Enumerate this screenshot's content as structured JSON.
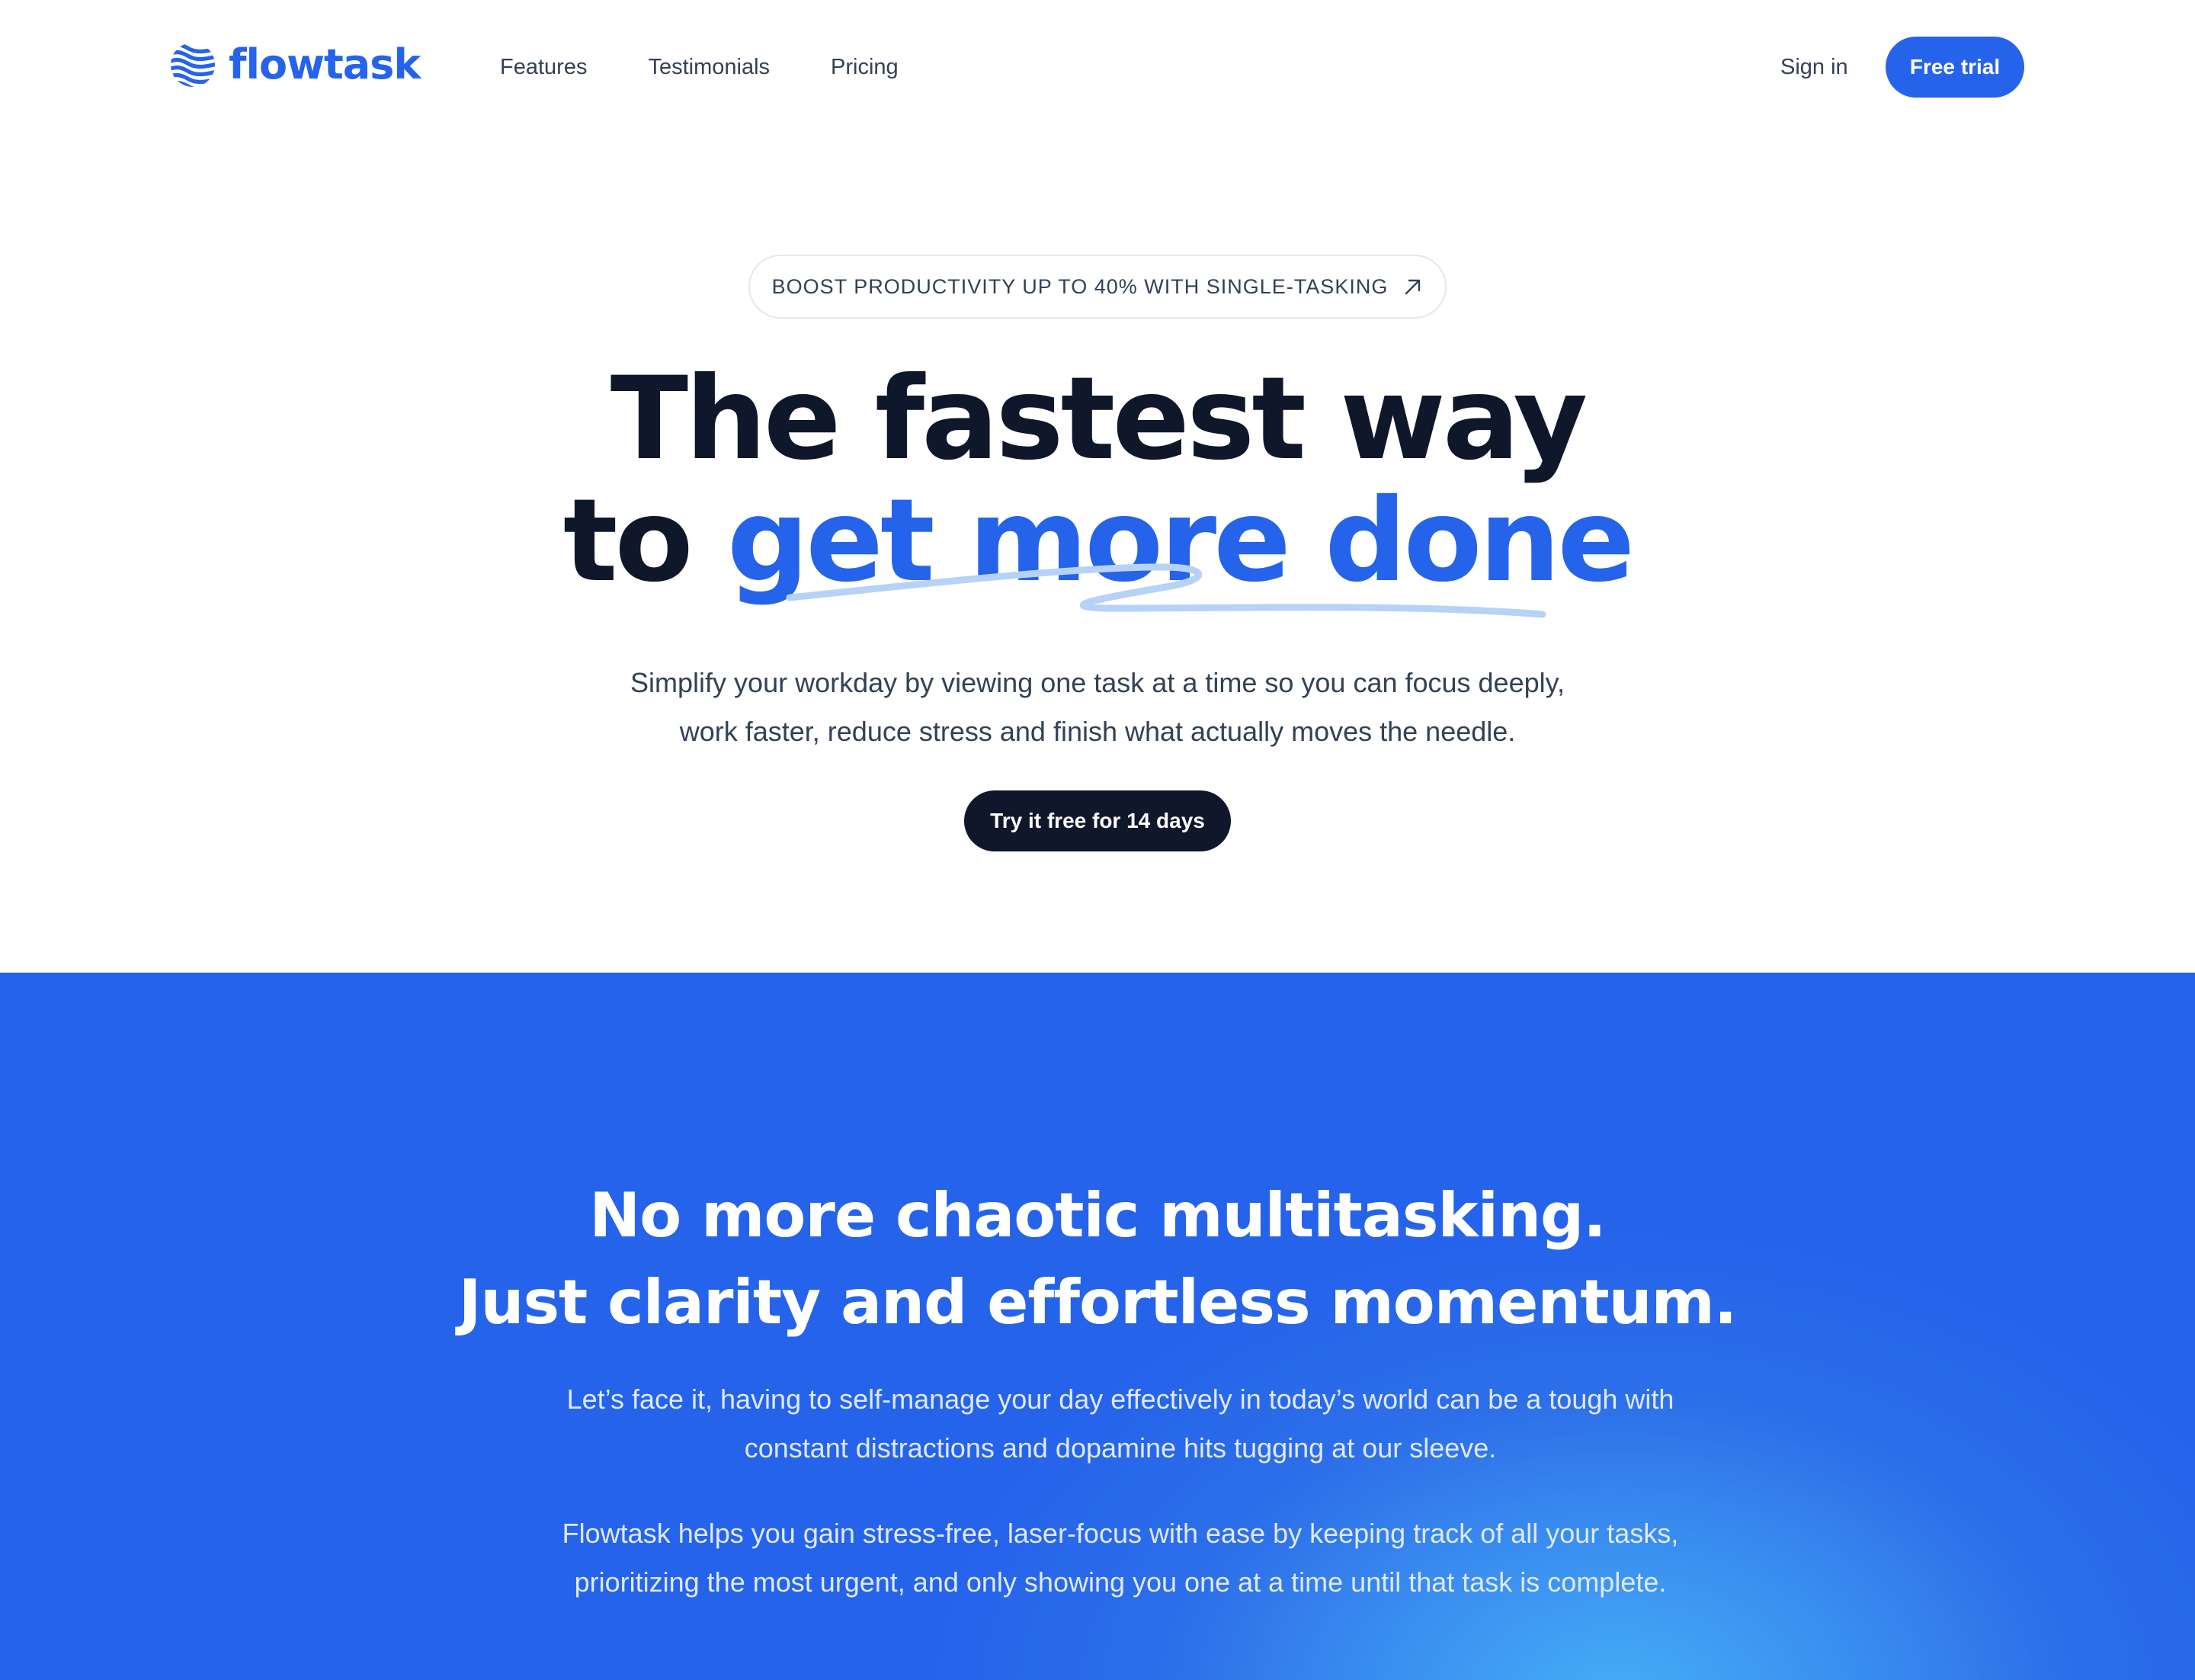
{
  "colors": {
    "brand": "#2563eb",
    "dark": "#0f172a",
    "text_muted": "#334155",
    "scribble": "#b6d3f7",
    "section_bg": "#2563eb",
    "section_glow": "#45aef6"
  },
  "nav": {
    "logo_icon": "wave-globe-icon",
    "logo_text": "flowtask",
    "links": [
      "Features",
      "Testimonials",
      "Pricing"
    ],
    "sign_in": "Sign in",
    "cta": "Free trial"
  },
  "hero": {
    "badge": "BOOST PRODUCTIVITY UP TO 40% WITH SINGLE-TASKING",
    "badge_icon": "arrow-up-right-icon",
    "title_line1": "The fastest way",
    "title_line2_prefix": "to ",
    "title_line2_highlight": "get more done",
    "subtitle_line1": "Simplify your workday by viewing one task at a time so you can focus deeply,",
    "subtitle_line2": "work faster, reduce stress and finish what actually moves the needle.",
    "cta": "Try it free for 14 days"
  },
  "section": {
    "title_line1": "No more chaotic multitasking.",
    "title_line2": "Just clarity and effortless momentum.",
    "p1_line1": "Let’s face it, having to self-manage your day effectively in today’s world can be a tough with",
    "p1_line2": "constant distractions and dopamine hits tugging at our sleeve.",
    "p2_line1": "Flowtask helps you gain stress-free, laser-focus with ease by keeping track of all your tasks,",
    "p2_line2": "prioritizing the most urgent, and only showing you one at a time until that task is complete."
  }
}
